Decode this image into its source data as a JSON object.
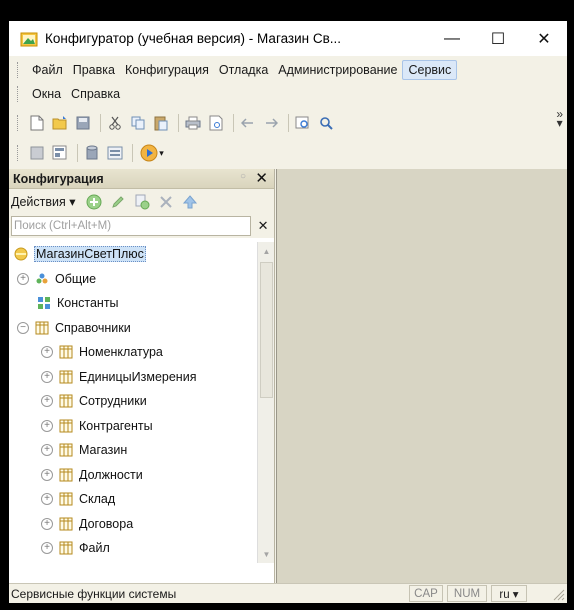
{
  "window": {
    "title": "Конфигуратор (учебная версия) - Магазин Св...",
    "minimize": "—",
    "maximize": "☐",
    "close": "✕"
  },
  "menu": {
    "row1": [
      "Файл",
      "Правка",
      "Конфигурация",
      "Отладка",
      "Администрирование",
      "Сервис"
    ],
    "row2": [
      "Окна",
      "Справка"
    ]
  },
  "panel": {
    "title": "Конфигурация",
    "actions_label": "Действия ▾",
    "search_placeholder": "Поиск (Ctrl+Alt+M)",
    "close": "✕",
    "search_clear": "✕"
  },
  "tree": [
    {
      "label": "МагазинСветПлюс",
      "selected": true
    },
    {
      "label": "Общие"
    },
    {
      "label": "Константы"
    },
    {
      "label": "Справочники"
    },
    {
      "label": "Номенклатура"
    },
    {
      "label": "ЕдиницыИзмерения"
    },
    {
      "label": "Сотрудники"
    },
    {
      "label": "Контрагенты"
    },
    {
      "label": "Магазин"
    },
    {
      "label": "Должности"
    },
    {
      "label": "Склад"
    },
    {
      "label": "Договора"
    },
    {
      "label": "Файл"
    }
  ],
  "statusbar": {
    "text": "Сервисные функции системы",
    "cap": "CAP",
    "num": "NUM",
    "lang": "ru ▾"
  },
  "toolbar": {
    "overflow": "»"
  },
  "colors": {
    "chrome": "#f3f1e6",
    "workspace": "#d8d5c4",
    "selected": "#cde2f7",
    "menu_active": "#dbe8f8"
  }
}
